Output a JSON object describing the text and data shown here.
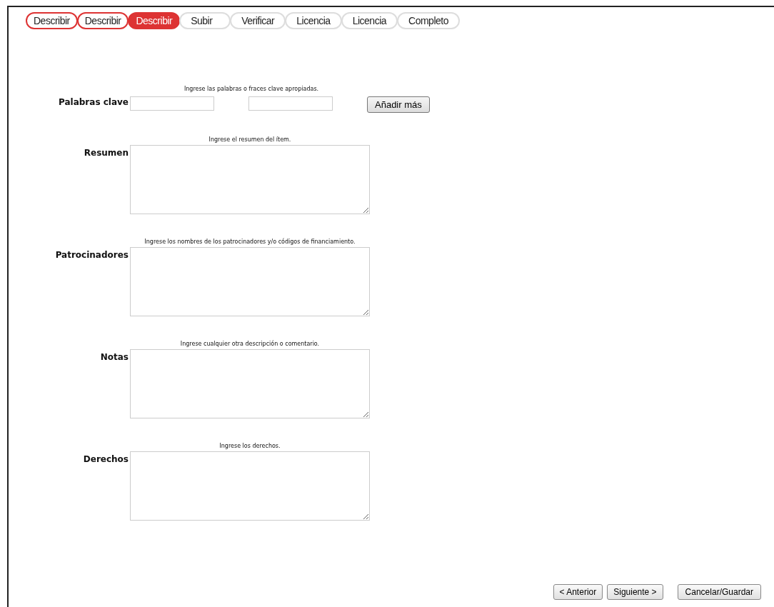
{
  "steps": [
    {
      "label": "Describir",
      "done": true,
      "selected": false
    },
    {
      "label": "Describir",
      "done": true,
      "selected": false
    },
    {
      "label": "Describir",
      "selected": true
    },
    {
      "label": "Subir",
      "done": false,
      "selected": false
    },
    {
      "label": "Verificar",
      "done": false,
      "selected": false
    },
    {
      "label": "Licencia",
      "done": false,
      "selected": false
    },
    {
      "label": "Licencia",
      "done": false,
      "selected": false
    },
    {
      "label": "Completo",
      "done": false,
      "selected": false
    }
  ],
  "keywords": {
    "label": "Palabras clave",
    "hint": "Ingrese las palabras o fraces clave apropiadas.",
    "add_button": "Añadir más"
  },
  "fields": [
    {
      "label": "Resumen",
      "hint": "Ingrese el resumen del ítem."
    },
    {
      "label": "Patrocinadores",
      "hint": "Ingrese los nombres de los patrocinadores y/o códigos de financiamiento."
    },
    {
      "label": "Notas",
      "hint": "Ingrese cualquier otra descripción o comentario."
    },
    {
      "label": "Derechos",
      "hint": "Ingrese los derechos."
    }
  ],
  "buttons": [
    "< Anterior",
    "Siguiente >",
    "Cancelar/Guardar"
  ]
}
